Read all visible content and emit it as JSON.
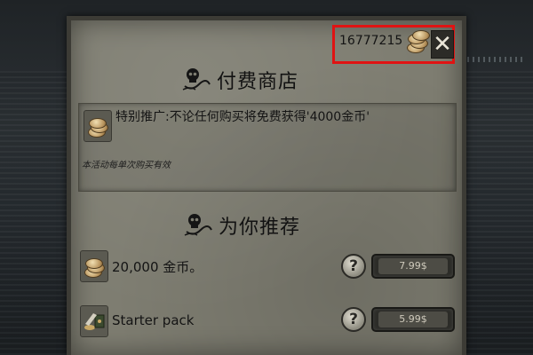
{
  "shop": {
    "coin_balance": "16777215",
    "close_label": "✕",
    "title": "付费商店",
    "promo": {
      "text": "特别推广:不论任何购买将免费获得'4000金币'",
      "note": "本活动每单次购买有效"
    },
    "recommend_title": "为你推荐",
    "items": [
      {
        "label": "20,000 金币。",
        "help": "?",
        "price": "7.99$"
      },
      {
        "label": "Starter pack",
        "help": "?",
        "price": "5.99$"
      }
    ]
  },
  "icons": {
    "coin": "coin-stack-icon",
    "close": "close-icon",
    "skull": "skull-icon",
    "starter": "starter-pack-icon"
  },
  "colors": {
    "highlight": "#e01313",
    "panel": "#7e7d71",
    "button_dark": "#2c2c28"
  }
}
